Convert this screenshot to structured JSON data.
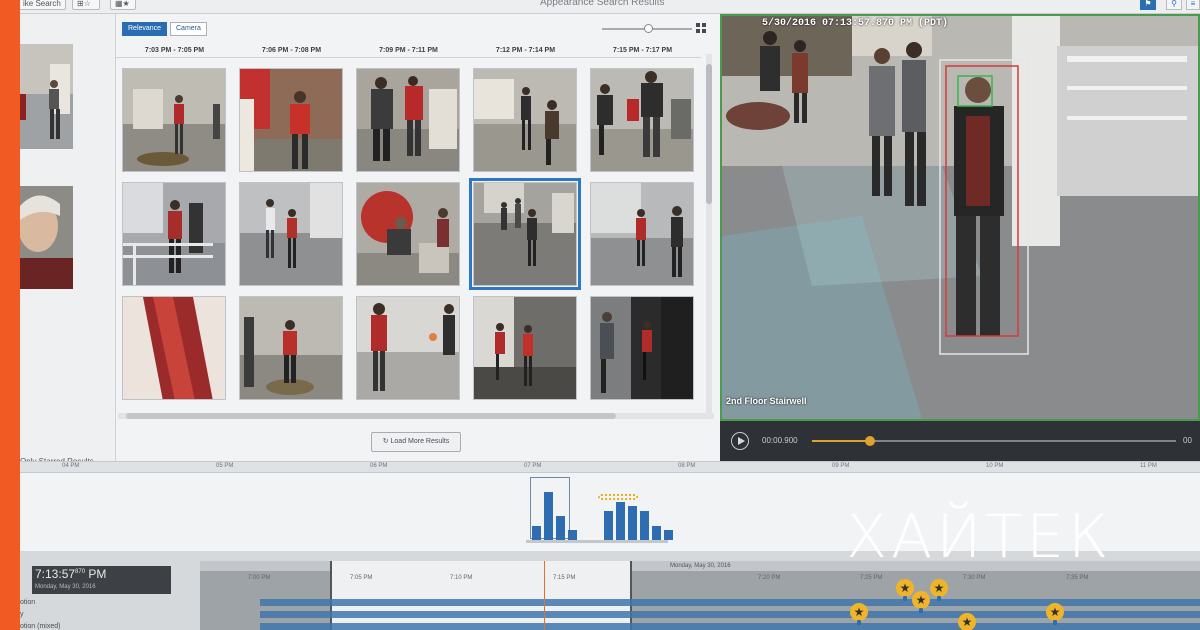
{
  "window": {
    "title": "Appearance Search Results",
    "left_tab_label": "ike Search",
    "toolbar_icons": [
      "person-icon",
      "zoom-icon",
      "menu-icon"
    ]
  },
  "left_panel": {
    "starred_label": "Only Starred Results"
  },
  "results": {
    "sort_options": [
      "Relevance",
      "Camera"
    ],
    "active_sort": "Relevance",
    "columns": [
      "7:03 PM - 7:05 PM",
      "7:06 PM - 7:08 PM",
      "7:09 PM - 7:11 PM",
      "7:12 PM - 7:14 PM",
      "7:15 PM - 7:17 PM"
    ],
    "load_more_label": "Load More Results"
  },
  "video": {
    "timestamp": "5/30/2016 07:13:57.870 PM (PDT)",
    "camera_name": "2nd Floor Stairwell",
    "current_time": "00:00.900",
    "end_time": "00",
    "progress": 0.16
  },
  "timeline": {
    "ruler_labels": [
      "04 PM",
      "05 PM",
      "06 PM",
      "07 PM",
      "08 PM",
      "09 PM",
      "10 PM",
      "11 PM"
    ],
    "current_time": "7:13:57",
    "current_time_ms": "870",
    "current_ampm": "PM",
    "current_date": "Monday, May 30, 2016",
    "day_label": "Monday, May 30, 2016",
    "tick_labels": [
      "7:00 PM",
      "7:05 PM",
      "7:10 PM",
      "7:15 PM",
      "7:20 PM",
      "7:25 PM",
      "7:30 PM",
      "7:35 PM"
    ],
    "row_labels": [
      "otion",
      "y",
      "otion (mixed)"
    ],
    "histogram_values": [
      3,
      10,
      5,
      2,
      0,
      0,
      6,
      8,
      7,
      6,
      3,
      2
    ]
  },
  "brand": {
    "logo_text": "ХАЙТЕК",
    "strip_color": "#f15a22"
  }
}
